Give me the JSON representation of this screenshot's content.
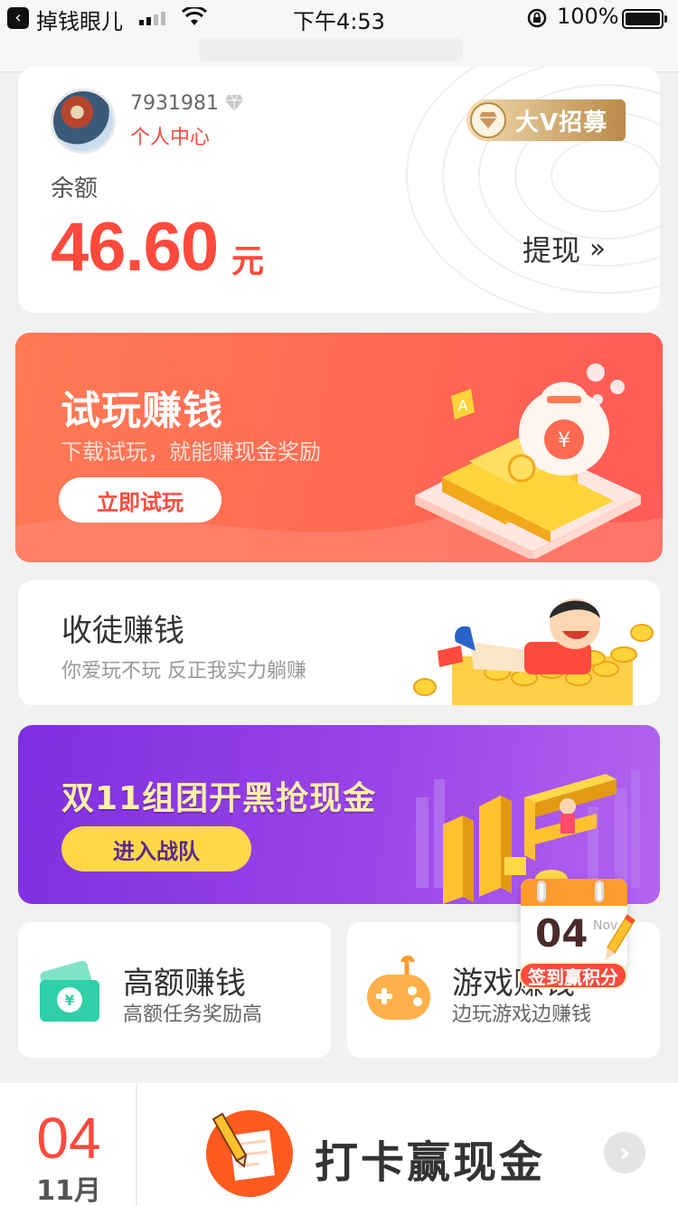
{
  "status_bar": {
    "app_name": "掉钱眼儿",
    "time": "下午4:53",
    "battery": "100%"
  },
  "profile": {
    "user_id": "7931981",
    "center_label": "个人中心",
    "vip_button": "大V招募",
    "balance_label": "余额",
    "balance_amount": "46.60",
    "balance_unit": "元",
    "withdraw_label": "提现"
  },
  "trial_banner": {
    "title": "试玩赚钱",
    "subtitle": "下载试玩，就能赚现金奖励",
    "button": "立即试玩"
  },
  "apprentice": {
    "title": "收徒赚钱",
    "subtitle": "你爱玩不玩 反正我实力躺赚"
  },
  "d11_banner": {
    "title": "双11组团开黑抢现金",
    "button": "进入战队"
  },
  "highpay": {
    "title": "高额赚钱",
    "subtitle": "高额任务奖励高"
  },
  "games": {
    "title": "游戏赚钱",
    "subtitle": "边玩游戏边赚钱"
  },
  "checkin_float": {
    "day": "04",
    "month": "Nov",
    "badge": "签到赢积分"
  },
  "bottom": {
    "day": "04",
    "month": "11月",
    "title": "打卡赢现金"
  },
  "colors": {
    "accent_red": "#ff4a3d",
    "trial_orange": "#ff6a52",
    "d11_purple": "#9a45e8",
    "gold": "#ffd84a"
  }
}
